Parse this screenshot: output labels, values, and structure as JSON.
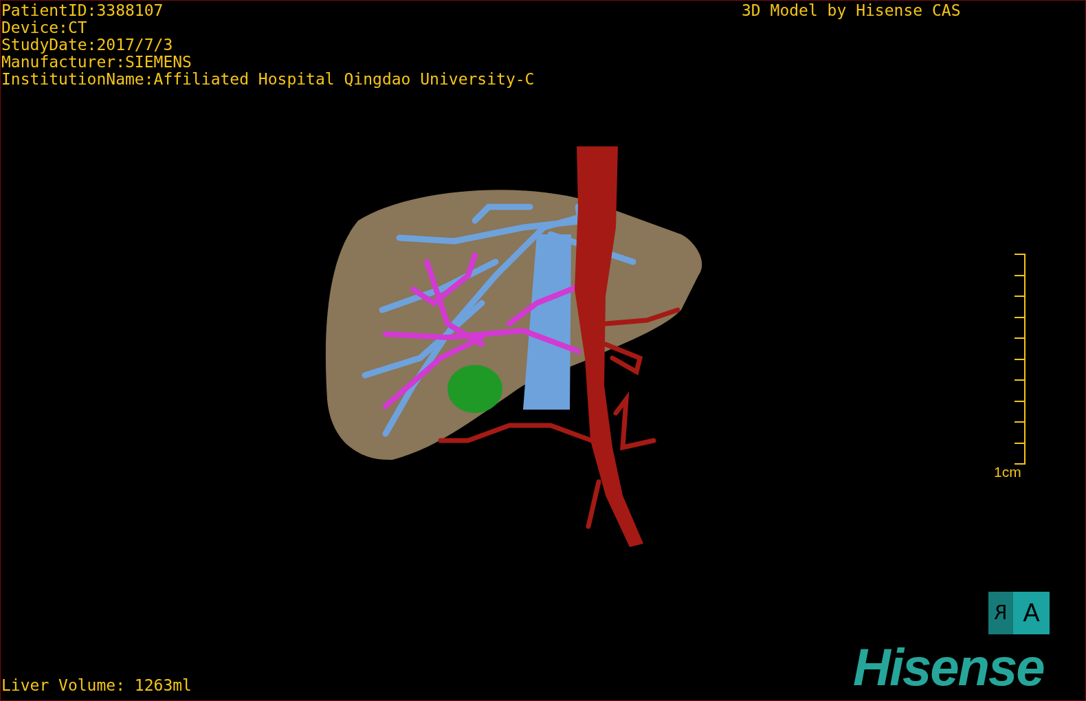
{
  "patient_info": [
    "PatientID:3388107",
    "Device:CT",
    "StudyDate:2017/7/3",
    "Manufacturer:SIEMENS",
    "InstitutionName:Affiliated Hospital Qingdao University-C"
  ],
  "model_credit": "3D Model by Hisense CAS",
  "scale_bar": {
    "label": "1cm"
  },
  "orientation_cube": {
    "side_label": "R",
    "front_label": "A"
  },
  "liver_volume": "Liver Volume: 1263ml",
  "logo": "Hisense"
}
